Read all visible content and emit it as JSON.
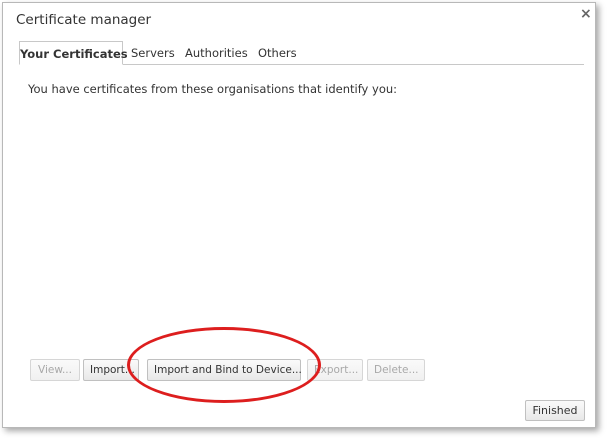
{
  "dialog": {
    "title": "Certificate manager",
    "close_symbol": "×"
  },
  "tabs": [
    {
      "label": "Your Certificates",
      "active": true
    },
    {
      "label": "Servers",
      "active": false
    },
    {
      "label": "Authorities",
      "active": false
    },
    {
      "label": "Others",
      "active": false
    }
  ],
  "panel": {
    "description": "You have certificates from these organisations that identify you:"
  },
  "buttons": {
    "view": "View...",
    "import": "Import...",
    "import_bind": "Import and Bind to Device...",
    "export": "Export...",
    "delete": "Delete...",
    "finished": "Finished"
  },
  "colors": {
    "highlight": "#dd1e1e",
    "text": "#333333",
    "disabled_text": "#a8a8a8"
  }
}
